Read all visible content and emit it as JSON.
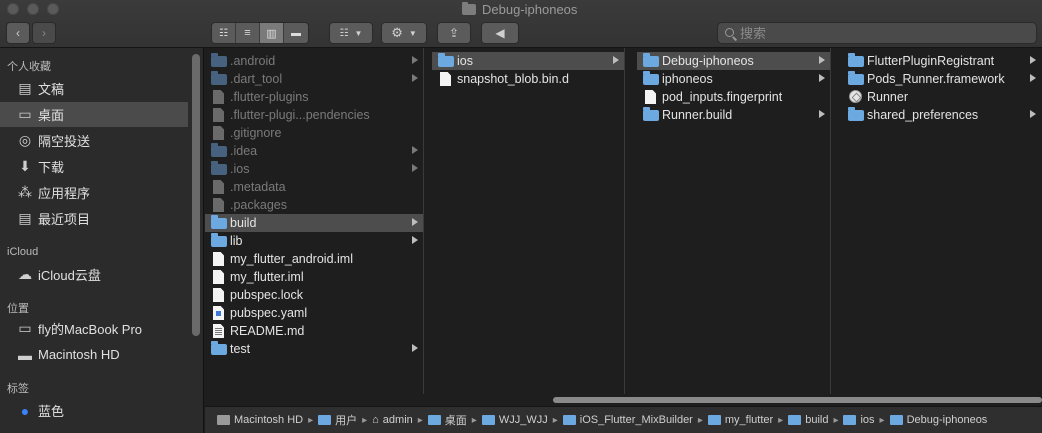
{
  "window": {
    "title": "Debug-iphoneos"
  },
  "toolbar": {
    "search_placeholder": "搜索"
  },
  "sidebar": {
    "sections": [
      {
        "header": "个人收藏",
        "items": [
          {
            "label": "文稿",
            "icon": "documents-icon"
          },
          {
            "label": "桌面",
            "icon": "desktop-icon",
            "selected": true
          },
          {
            "label": "隔空投送",
            "icon": "airdrop-icon"
          },
          {
            "label": "下载",
            "icon": "downloads-icon"
          },
          {
            "label": "应用程序",
            "icon": "applications-icon"
          },
          {
            "label": "最近项目",
            "icon": "recents-icon"
          }
        ]
      },
      {
        "header": "iCloud",
        "items": [
          {
            "label": "iCloud云盘",
            "icon": "icloud-icon"
          }
        ]
      },
      {
        "header": "位置",
        "items": [
          {
            "label": "fly的MacBook Pro",
            "icon": "laptop-icon"
          },
          {
            "label": "Macintosh HD",
            "icon": "hard-drive-icon"
          }
        ]
      },
      {
        "header": "标签",
        "items": [
          {
            "label": "蓝色",
            "icon": "blue-tag-icon",
            "color": "#3b82f6"
          }
        ]
      }
    ]
  },
  "columns": [
    {
      "items": [
        {
          "name": ".android",
          "kind": "folder",
          "dim": true,
          "arrow": true
        },
        {
          "name": ".dart_tool",
          "kind": "folder",
          "dim": true,
          "arrow": true
        },
        {
          "name": ".flutter-plugins",
          "kind": "file",
          "dim": true
        },
        {
          "name": ".flutter-plugi...pendencies",
          "kind": "file",
          "dim": true
        },
        {
          "name": ".gitignore",
          "kind": "file",
          "dim": true
        },
        {
          "name": ".idea",
          "kind": "folder",
          "dim": true,
          "arrow": true
        },
        {
          "name": ".ios",
          "kind": "folder",
          "dim": true,
          "arrow": true
        },
        {
          "name": ".metadata",
          "kind": "file",
          "dim": true
        },
        {
          "name": ".packages",
          "kind": "file",
          "dim": true
        },
        {
          "name": "build",
          "kind": "folder",
          "arrow": true,
          "selected": true
        },
        {
          "name": "lib",
          "kind": "folder",
          "arrow": true
        },
        {
          "name": "my_flutter_android.iml",
          "kind": "file"
        },
        {
          "name": "my_flutter.iml",
          "kind": "file"
        },
        {
          "name": "pubspec.lock",
          "kind": "file"
        },
        {
          "name": "pubspec.yaml",
          "kind": "yaml"
        },
        {
          "name": "README.md",
          "kind": "readme"
        },
        {
          "name": "test",
          "kind": "folder",
          "arrow": true
        }
      ]
    },
    {
      "items": [
        {
          "name": "ios",
          "kind": "folder",
          "arrow": true,
          "selected": true
        },
        {
          "name": "snapshot_blob.bin.d",
          "kind": "file"
        }
      ]
    },
    {
      "items": [
        {
          "name": "Debug-iphoneos",
          "kind": "folder",
          "arrow": true,
          "selected": true
        },
        {
          "name": "iphoneos",
          "kind": "folder",
          "arrow": true
        },
        {
          "name": "pod_inputs.fingerprint",
          "kind": "file"
        },
        {
          "name": "Runner.build",
          "kind": "folder",
          "arrow": true
        }
      ]
    },
    {
      "items": [
        {
          "name": "FlutterPluginRegistrant",
          "kind": "folder",
          "arrow": true
        },
        {
          "name": "Pods_Runner.framework",
          "kind": "folder",
          "arrow": true
        },
        {
          "name": "Runner",
          "kind": "app"
        },
        {
          "name": "shared_preferences",
          "kind": "folder",
          "arrow": true
        }
      ]
    }
  ],
  "pathbar": [
    {
      "label": "Macintosh HD",
      "icon": "hard-drive-icon"
    },
    {
      "label": "用户",
      "icon": "folder-icon"
    },
    {
      "label": "admin",
      "icon": "home-icon"
    },
    {
      "label": "桌面",
      "icon": "folder-icon"
    },
    {
      "label": "WJJ_WJJ",
      "icon": "folder-icon"
    },
    {
      "label": "iOS_Flutter_MixBuilder",
      "icon": "folder-icon"
    },
    {
      "label": "my_flutter",
      "icon": "folder-icon"
    },
    {
      "label": "build",
      "icon": "folder-icon"
    },
    {
      "label": "ios",
      "icon": "folder-icon"
    },
    {
      "label": "Debug-iphoneos",
      "icon": "folder-icon"
    }
  ]
}
